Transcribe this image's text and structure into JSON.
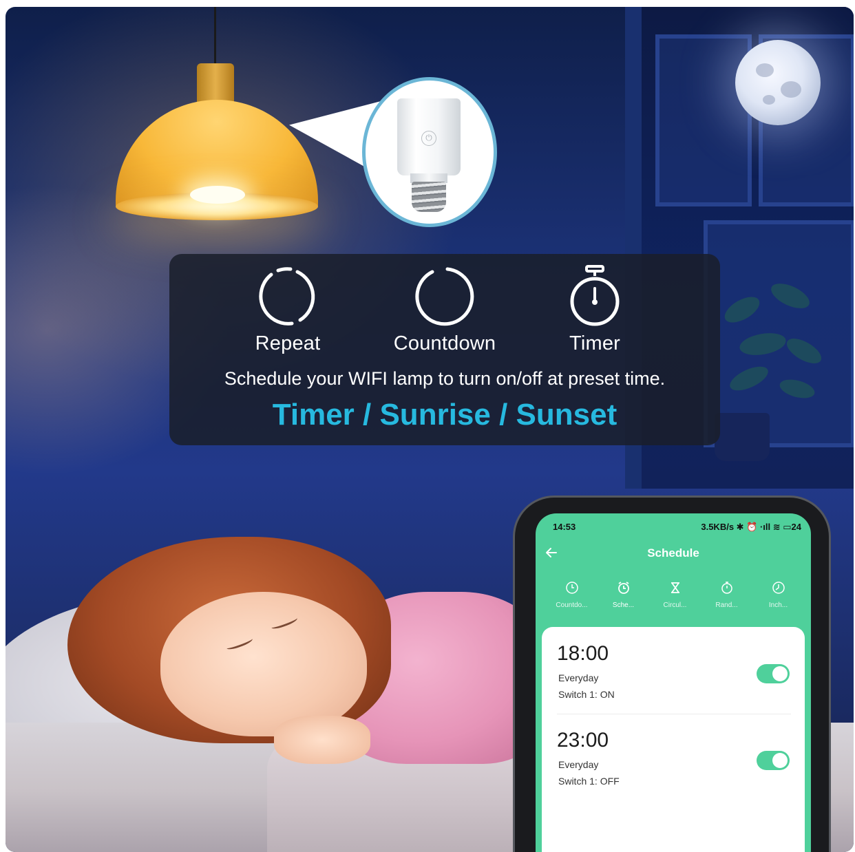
{
  "features": [
    {
      "label": "Repeat",
      "icon": "repeat-icon"
    },
    {
      "label": "Countdown",
      "icon": "countdown-icon"
    },
    {
      "label": "Timer",
      "icon": "stopwatch-icon"
    }
  ],
  "description": "Schedule your WIFI lamp to turn on/off at preset time.",
  "highlight": "Timer / Sunrise / Sunset",
  "phone": {
    "status_time": "14:53",
    "status_right": "3.5KB/s ✱ ⏰ ·ıll ≋ ▭24",
    "app_title": "Schedule",
    "back_icon": "back-arrow-icon",
    "tabs": [
      {
        "label": "Countdo...",
        "icon": "clock-icon"
      },
      {
        "label": "Sche...",
        "icon": "alarm-icon"
      },
      {
        "label": "Circul...",
        "icon": "hourglass-icon"
      },
      {
        "label": "Rand...",
        "icon": "stopwatch-icon"
      },
      {
        "label": "Inch...",
        "icon": "clock-icon"
      }
    ],
    "schedules": [
      {
        "time": "18:00",
        "repeat": "Everyday",
        "action": "Switch 1: ON",
        "enabled": true
      },
      {
        "time": "23:00",
        "repeat": "Everyday",
        "action": "Switch 1: OFF",
        "enabled": true
      }
    ]
  },
  "colors": {
    "accent_green": "#4fd09b",
    "highlight_blue": "#27b9df",
    "panel_bg": "#1a1e2a"
  }
}
